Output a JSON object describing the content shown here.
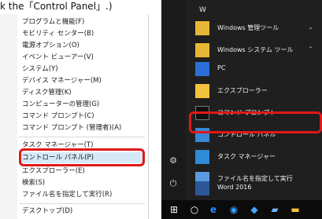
{
  "caption": "k the「Control Panel」.)",
  "winx_menu": {
    "items": [
      "プログラムと機能(F)",
      "モビリティ センター(B)",
      "電源オプション(O)",
      "イベント ビューアー(V)",
      "システム(Y)",
      "デバイス マネージャー(M)",
      "ディスク管理(K)",
      "コンピューターの管理(G)",
      "コマンド プロンプト(C)",
      "コマンド プロンプト (管理者)(A)",
      "タスク マネージャー(T)",
      "コントロール パネル(P)",
      "エクスプローラー(E)",
      "検索(S)",
      "ファイル名を指定して実行(R)",
      "デスクトップ(D)"
    ]
  },
  "start_menu": {
    "section_letter": "W",
    "items": [
      {
        "label": "Windows 管理ツール",
        "icon": "folder-icon"
      },
      {
        "label": "Windows システム ツール",
        "icon": "folder-icon"
      },
      {
        "label": "PC",
        "icon": "pc-icon"
      },
      {
        "label": "エクスプローラー",
        "icon": "explorer-icon"
      },
      {
        "label": "コマンド プロンプト",
        "icon": "cmd-icon"
      },
      {
        "label": "コントロール パネル",
        "icon": "control-panel-icon"
      },
      {
        "label": "タスク マネージャー",
        "icon": "task-manager-icon"
      },
      {
        "label": "ファイル名を指定して実行",
        "icon": "run-icon"
      },
      {
        "label": "Word 2016",
        "icon": "word-icon"
      }
    ]
  },
  "colors": {
    "highlight_red": "#e01818",
    "start_bg": "#1f1f1f",
    "accent_blue": "#1e90ff"
  }
}
